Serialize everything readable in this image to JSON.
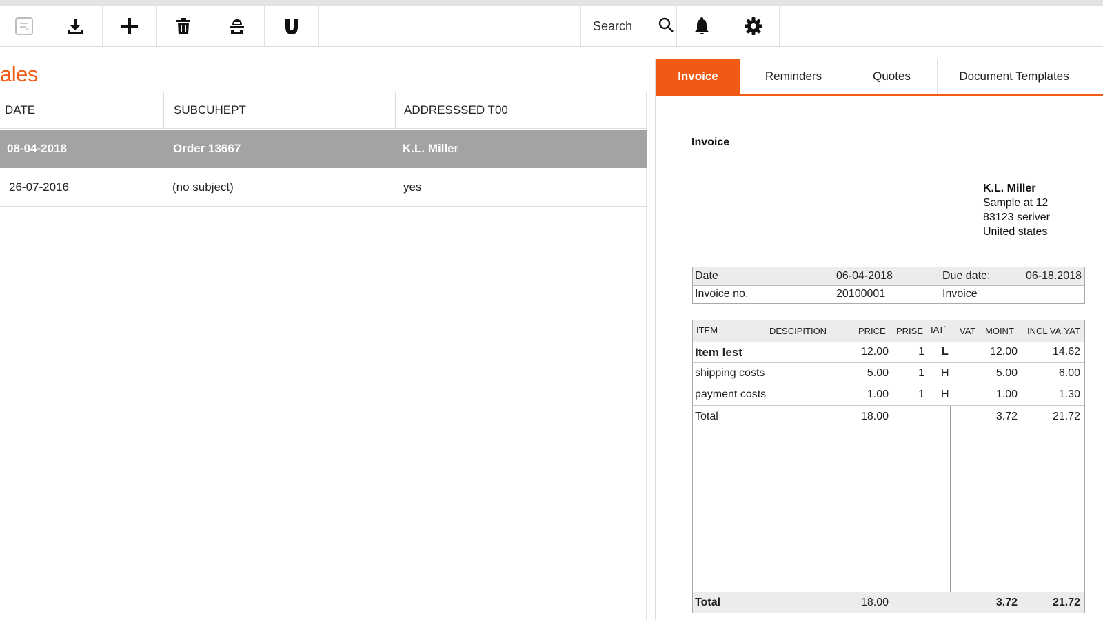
{
  "toolbar": {
    "buttons": [
      {
        "icon": "document-icon"
      },
      {
        "icon": "download-icon"
      },
      {
        "icon": "plus-icon"
      },
      {
        "icon": "trash-icon"
      },
      {
        "icon": "contact-icon"
      },
      {
        "icon": "magnet-icon"
      }
    ],
    "search_placeholder": "Search",
    "search_icon": "search-icon",
    "bell_icon": "bell-icon",
    "settings_icon": "gear-icon"
  },
  "left": {
    "title": "ales",
    "columns": [
      "DATE",
      "SUBCUHEPT",
      "ADDRESSSED T00"
    ],
    "rows": [
      {
        "date": "08-04-2018",
        "subject": "Order 13667",
        "addressed": "K.L. Miller"
      },
      {
        "date": "26-07-2016",
        "subject": "(no subject)",
        "addressed": "yes"
      }
    ]
  },
  "right": {
    "tabs": [
      "Invoice",
      "Reminders",
      "Quotes",
      "Document Templates"
    ],
    "active_tab": "Invoice",
    "doc": {
      "title": "Invoice",
      "recipient": {
        "name": "K.L. Miller",
        "line1": "Sample at 12",
        "line2": "83123 seriver",
        "line3": "United states"
      },
      "meta": {
        "date_label": "Date",
        "date_value": "06-04-2018",
        "due_label": "Due date:",
        "due_value": "06-18.2018",
        "invoice_no_label": "Invoice no.",
        "invoice_no_value": "20100001",
        "type_value": "Invoice"
      },
      "items_header": [
        "ITEM",
        "DESCIPITION",
        "PRICE",
        "PRISE",
        "IAT˙",
        "VAT",
        "MOINT",
        "INCL VA˙YAT"
      ],
      "items": [
        {
          "item": "Item lest",
          "price": "12.00",
          "qty": "1",
          "vat_code": "L",
          "amount": "12.00",
          "incl": "14.62"
        },
        {
          "item": "shipping costs",
          "price": "5.00",
          "qty": "1",
          "vat_code": "H",
          "amount": "5.00",
          "incl": "6.00"
        },
        {
          "item": "payment costs",
          "price": "1.00",
          "qty": "1",
          "vat_code": "H",
          "amount": "1.00",
          "incl": "1.30"
        }
      ],
      "subtotal": {
        "label": "Total",
        "price": "18.00",
        "amount": "3.72",
        "incl": "21.72"
      },
      "total": {
        "label": "Total",
        "price": "18.00",
        "amount": "3.72",
        "incl": "21.72"
      }
    }
  },
  "colors": {
    "accent": "#f15a14",
    "selected_row": "#a3a3a3"
  }
}
